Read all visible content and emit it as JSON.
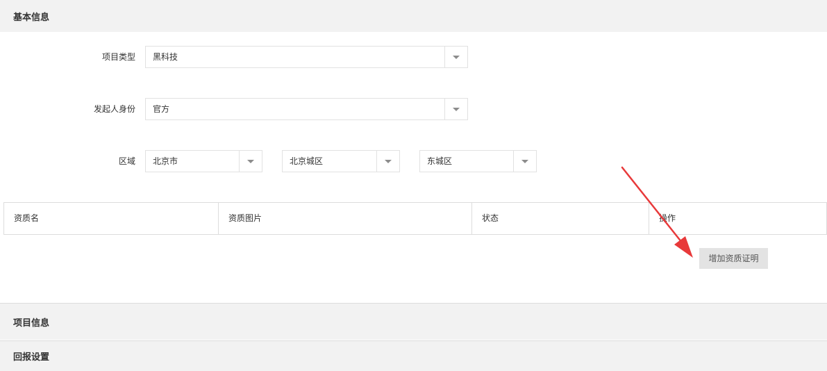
{
  "sections": {
    "basic_info": "基本信息",
    "project_info": "项目信息",
    "reward_settings": "回报设置"
  },
  "form": {
    "project_type": {
      "label": "项目类型",
      "value": "黑科技"
    },
    "initiator_identity": {
      "label": "发起人身份",
      "value": "官方"
    },
    "region": {
      "label": "区域",
      "province": "北京市",
      "city": "北京城区",
      "district": "东城区"
    }
  },
  "qualification_table": {
    "columns": [
      "资质名",
      "资质图片",
      "状态",
      "操作"
    ]
  },
  "add_qualification_button": "增加资质证明",
  "colors": {
    "section_bg": "#f2f2f2",
    "border": "#dcdcdc",
    "annotation_arrow": "#e8393a",
    "button_bg": "#e3e3e3"
  },
  "icons": {
    "dropdown": "chevron-down-icon",
    "annotation": "red-arrow-annotation"
  }
}
